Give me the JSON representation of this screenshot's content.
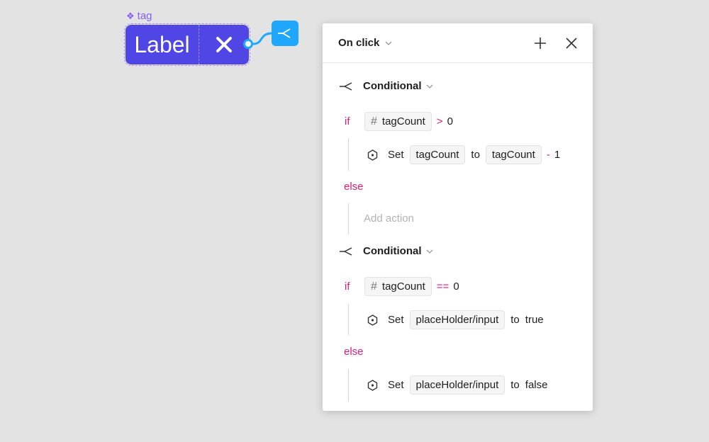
{
  "component": {
    "name": "tag",
    "label": "Label",
    "icon_close": "close-icon",
    "icon_component": "component-diamond-icon",
    "connector_icon": "conditional-branch-icon",
    "color_primary": "#4f46e5",
    "color_connector": "#1ea7fd"
  },
  "panel": {
    "trigger": "On click",
    "add_icon": "plus-icon",
    "close_icon": "close-icon",
    "blocks": [
      {
        "title": "Conditional",
        "if_keyword": "if",
        "condition": {
          "variable": "tagCount",
          "operator": ">",
          "value": "0"
        },
        "then_action": {
          "verb": "Set",
          "target": "tagCount",
          "to_word": "to",
          "expr_var": "tagCount",
          "expr_op": "-",
          "expr_num": "1"
        },
        "else_keyword": "else",
        "else_placeholder": "Add action"
      },
      {
        "title": "Conditional",
        "if_keyword": "if",
        "condition": {
          "variable": "tagCount",
          "operator": "==",
          "value": "0"
        },
        "then_action": {
          "verb": "Set",
          "target": "placeHolder/input",
          "to_word": "to",
          "value": "true"
        },
        "else_keyword": "else",
        "else_action": {
          "verb": "Set",
          "target": "placeHolder/input",
          "to_word": "to",
          "value": "false"
        }
      }
    ]
  }
}
